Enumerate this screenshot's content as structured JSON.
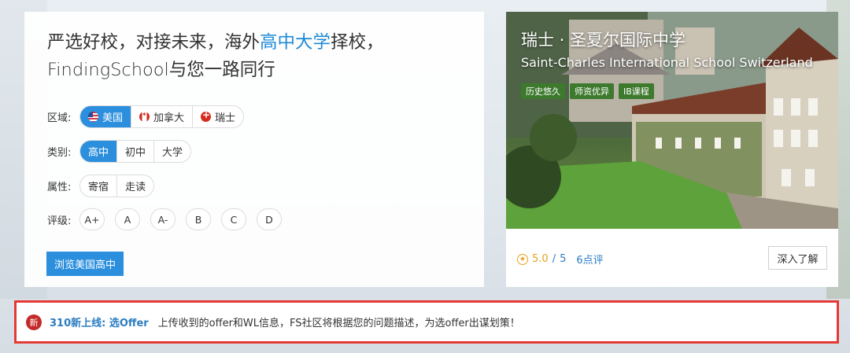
{
  "headline": {
    "line1_prefix": "严选好校，对接未来，海外",
    "line1_highlight": "高中大学",
    "line1_suffix": "择校，",
    "line2": "FindingSchool与您一路同行"
  },
  "filters": {
    "region": {
      "label": "区域:",
      "options": [
        "美国",
        "加拿大",
        "瑞士"
      ],
      "selected": "美国"
    },
    "category": {
      "label": "类别:",
      "options": [
        "高中",
        "初中",
        "大学"
      ],
      "selected": "高中"
    },
    "attribute": {
      "label": "属性:",
      "options": [
        "寄宿",
        "走读"
      ]
    },
    "grade": {
      "label": "评级:",
      "options": [
        "A+",
        "A",
        "A-",
        "B",
        "C",
        "D"
      ]
    }
  },
  "browse_button": "浏览美国高中",
  "school": {
    "title": "瑞士 · 圣夏尔国际中学",
    "subtitle": "Saint-Charles International School Switzerland",
    "tags": [
      "历史悠久",
      "师资优异",
      "IB课程"
    ],
    "score": "5.0",
    "separator": "/",
    "max_score": "5",
    "reviews": "6点评",
    "more_button": "深入了解"
  },
  "notice": {
    "badge": "新",
    "link": "310新上线: 选Offer",
    "text": "上传收到的offer和WL信息，FS社区将根据您的问题描述，为选offer出谋划策！"
  },
  "colors": {
    "accent": "#2b8fdd",
    "notice_border": "#e53935",
    "badge": "#c42a2a",
    "star": "#e7a21c",
    "tag": "#3d7a2e"
  }
}
